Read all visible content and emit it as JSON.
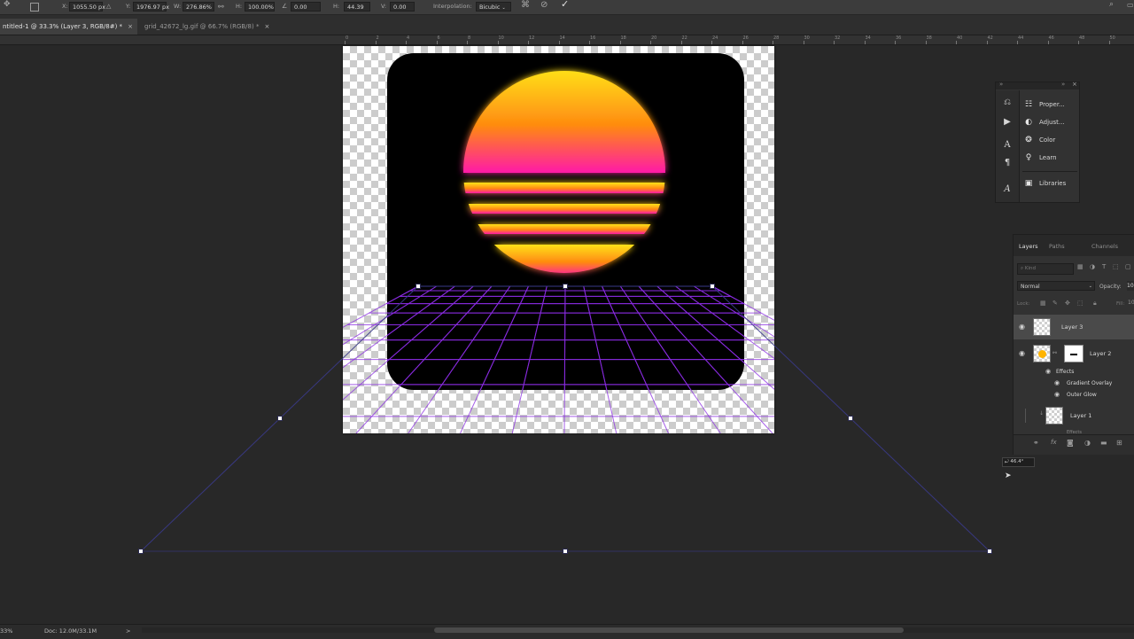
{
  "options_bar": {
    "x_label": "X:",
    "x_value": "1055.50 px",
    "y_label": "Y:",
    "y_value": "1976.97 px",
    "w_label": "W:",
    "w_value": "276.86%",
    "h_label": "H:",
    "h_value": "100.00%",
    "angle_value": "0.00",
    "hskew_label": "H:",
    "hskew_value": "44.39",
    "vskew_label": "V:",
    "vskew_value": "0.00",
    "interpolation_label": "Interpolation:",
    "interpolation_value": "Bicubic"
  },
  "tabs": [
    {
      "label": "ntitled-1 @ 33.3% (Layer 3, RGB/8#) *",
      "close": "×"
    },
    {
      "label": "grid_42672_lg.gif @ 66.7% (RGB/8) *",
      "close": "×"
    }
  ],
  "ruler_labels": [
    "0",
    "2",
    "4",
    "6",
    "8",
    "10",
    "12",
    "14",
    "16",
    "18",
    "20",
    "22",
    "24",
    "26",
    "28",
    "30",
    "32",
    "34",
    "36",
    "38",
    "40",
    "42",
    "44",
    "46",
    "48",
    "50"
  ],
  "float_panel": {
    "items": [
      {
        "label": "Proper...",
        "icon": "properties-icon"
      },
      {
        "label": "Adjust...",
        "icon": "adjustments-icon"
      },
      {
        "label": "Color",
        "icon": "color-icon"
      },
      {
        "label": "Learn",
        "icon": "learn-icon"
      },
      {
        "label": "Libraries",
        "icon": "libraries-icon"
      }
    ]
  },
  "layers_panel": {
    "tabs": [
      "Layers",
      "Paths",
      "Channels"
    ],
    "search_placeholder": "Kind",
    "blend_mode": "Normal",
    "opacity_label": "Opacity:",
    "opacity_value": "10",
    "lock_label": "Lock:",
    "fill_label": "Fill:",
    "fill_value": "10",
    "layers": [
      {
        "name": "Layer 3",
        "visible": true,
        "selected": true
      },
      {
        "name": "Layer 2",
        "visible": true,
        "selected": false
      },
      {
        "name": "Layer 1",
        "visible": false,
        "selected": false
      }
    ],
    "effects_label": "Effects",
    "effects": [
      "Gradient Overlay",
      "Outer Glow"
    ],
    "layer1_effects_label": "Effects"
  },
  "tooltip": {
    "value": "46.4°"
  },
  "status_bar": {
    "zoom": "33%",
    "doc": "Doc: 12.0M/33.1M",
    "arrow": ">"
  },
  "colors": {
    "sun_top": "#ffe21a",
    "sun_mid": "#ff8a10",
    "sun_bottom": "#ff1aa8",
    "grid": "#8a2be2",
    "panel_bg": "#323232",
    "workspace_bg": "#282828"
  }
}
